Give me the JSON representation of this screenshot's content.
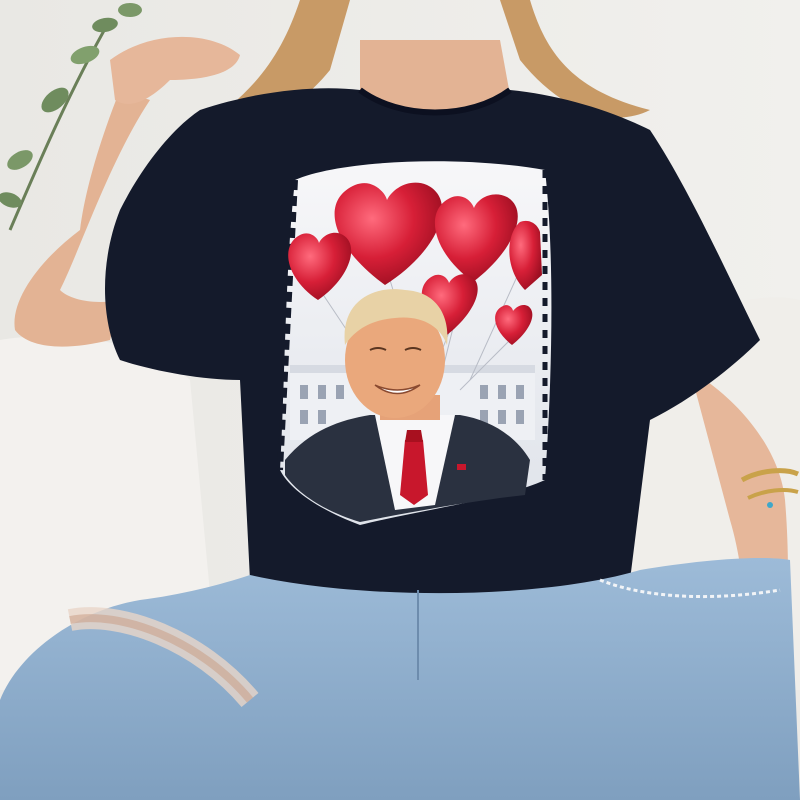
{
  "scene": {
    "description_label": "",
    "colors": {
      "wall": "#ecebe8",
      "sofa": "#f1efec",
      "tshirt": "#141a2b",
      "jeans": "#8fb0cf",
      "skin": "#e6b79a",
      "hair": "#c89a66",
      "balloon_red": "#d71f37",
      "suit": "#2a3140",
      "tie": "#c8172c",
      "house": "#eef0f4",
      "leaf": "#6f8c5e",
      "bracelet_gold": "#c9a24a",
      "bracelet_bead": "#3fa7c9"
    },
    "elements": {
      "print_icon": "portrait-with-heart-balloons-icon",
      "plant_icon": "houseplant-icon",
      "bracelet_icon": "bracelet-icon"
    }
  }
}
